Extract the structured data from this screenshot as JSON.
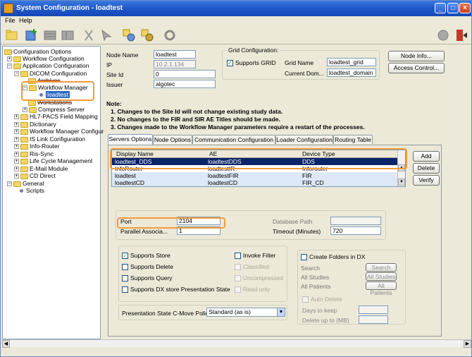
{
  "window": {
    "title": "System Configuration - loadtest",
    "controls": {
      "minimize": "_",
      "maximize": "□",
      "close": "×"
    }
  },
  "menu": {
    "file": "File",
    "help": "Help"
  },
  "toolbar_icons": [
    "new-folder-icon",
    "add-node-icon",
    "grid-icon",
    "grid-alt-icon",
    "cut-icon",
    "paste-icon",
    "node-config-icon",
    "node-settings-icon",
    "refresh-icon",
    "help-icon",
    "exit-icon"
  ],
  "tree": {
    "root": "Configuration Options",
    "items": [
      "Workflow Configuration",
      "Application Configuration",
      "DICOM Configuration",
      "Archives",
      "Workflow Manager",
      "loadtest",
      "Workstations",
      "Compress Server",
      "HL7-PACS Field Mapping",
      "Dictionary",
      "Workflow Manager Configur",
      "IS Link Configuration",
      "Info-Router",
      "Ris-Sync",
      "Life Cycle Management",
      "E-Mail Module",
      "CD Direct",
      "General",
      "Scripts"
    ]
  },
  "node": {
    "name_label": "Node Name",
    "name_value": "loadtest",
    "ip_label": "IP",
    "ip_value": "10.2.1.134",
    "siteid_label": "Site Id",
    "siteid_value": "0",
    "issuer_label": "Issuer",
    "issuer_value": "algotec"
  },
  "grid": {
    "group_title": "Grid Configuration:",
    "supports_grid": "Supports GRID",
    "grid_name_label": "Grid Name",
    "grid_name_value": "loadtest_grid",
    "current_dom_label": "Current Dom...",
    "current_dom_value": "loadtest_domain"
  },
  "buttons": {
    "node_info": "Node Info...",
    "access_control": "Access Control..."
  },
  "note": {
    "title": "Note:",
    "lines": [
      "1. Changes to the Site Id will not change existing study data.",
      "2. No changes to the FIR and SIR AE Titles should be made.",
      "3. Changes made to the Workflow Manager parameters require a restart of the processes."
    ]
  },
  "tabs": [
    "Servers Options",
    "Node Options",
    "Communication Configuration",
    "Loader Configuration",
    "Routing Table"
  ],
  "servers": {
    "columns": [
      "Display Name",
      "AE",
      "Device Type"
    ],
    "rows": [
      [
        "loadtest_DDS",
        "loadtestDDS",
        "DDS"
      ],
      [
        "InfoRouter",
        "loadtestIR",
        "Inforouter"
      ],
      [
        "loadtest",
        "loadtestFIR",
        "FIR"
      ],
      [
        "loadtestCD",
        "loadtestCD",
        "FIR_CD"
      ]
    ],
    "add": "Add",
    "delete": "Delete",
    "verify": "Verify"
  },
  "conn": {
    "port_label": "Port",
    "port_value": "2104",
    "parallel_label": "Parallel Associa...",
    "parallel_value": "1",
    "db_path_label": "Database Path",
    "db_path_value": "",
    "timeout_label": "Timeout (Minutes)",
    "timeout_value": "720"
  },
  "options": {
    "supports_store": "Supports Store",
    "supports_delete": "Supports Delete",
    "supports_query": "Supports Query",
    "supports_dx": "Supports DX store Presentation State",
    "invoke_filter": "Invoke Filter",
    "classified": "Classified",
    "uncompressed": "Uncompressed",
    "read_only": "Read only"
  },
  "dx": {
    "create_folders": "Create Folders in DX",
    "search_label": "Search",
    "search_btn": "Search",
    "all_studies_label": "All Studies",
    "all_studies_btn": "All Studies",
    "all_patients_label": "All Patients",
    "all_patients_btn": "All Patients",
    "auto_delete": "Auto Delete",
    "days_label": "Days to keep",
    "delete_up_label": "Delete up to (MB)"
  },
  "cmove": {
    "label": "Presentation State C-Move Policy...",
    "value": "Standard (as is)"
  },
  "colors": {
    "titlebar": "#1f57c9",
    "selection": "#0a246a",
    "highlight": "#f39c3a"
  }
}
